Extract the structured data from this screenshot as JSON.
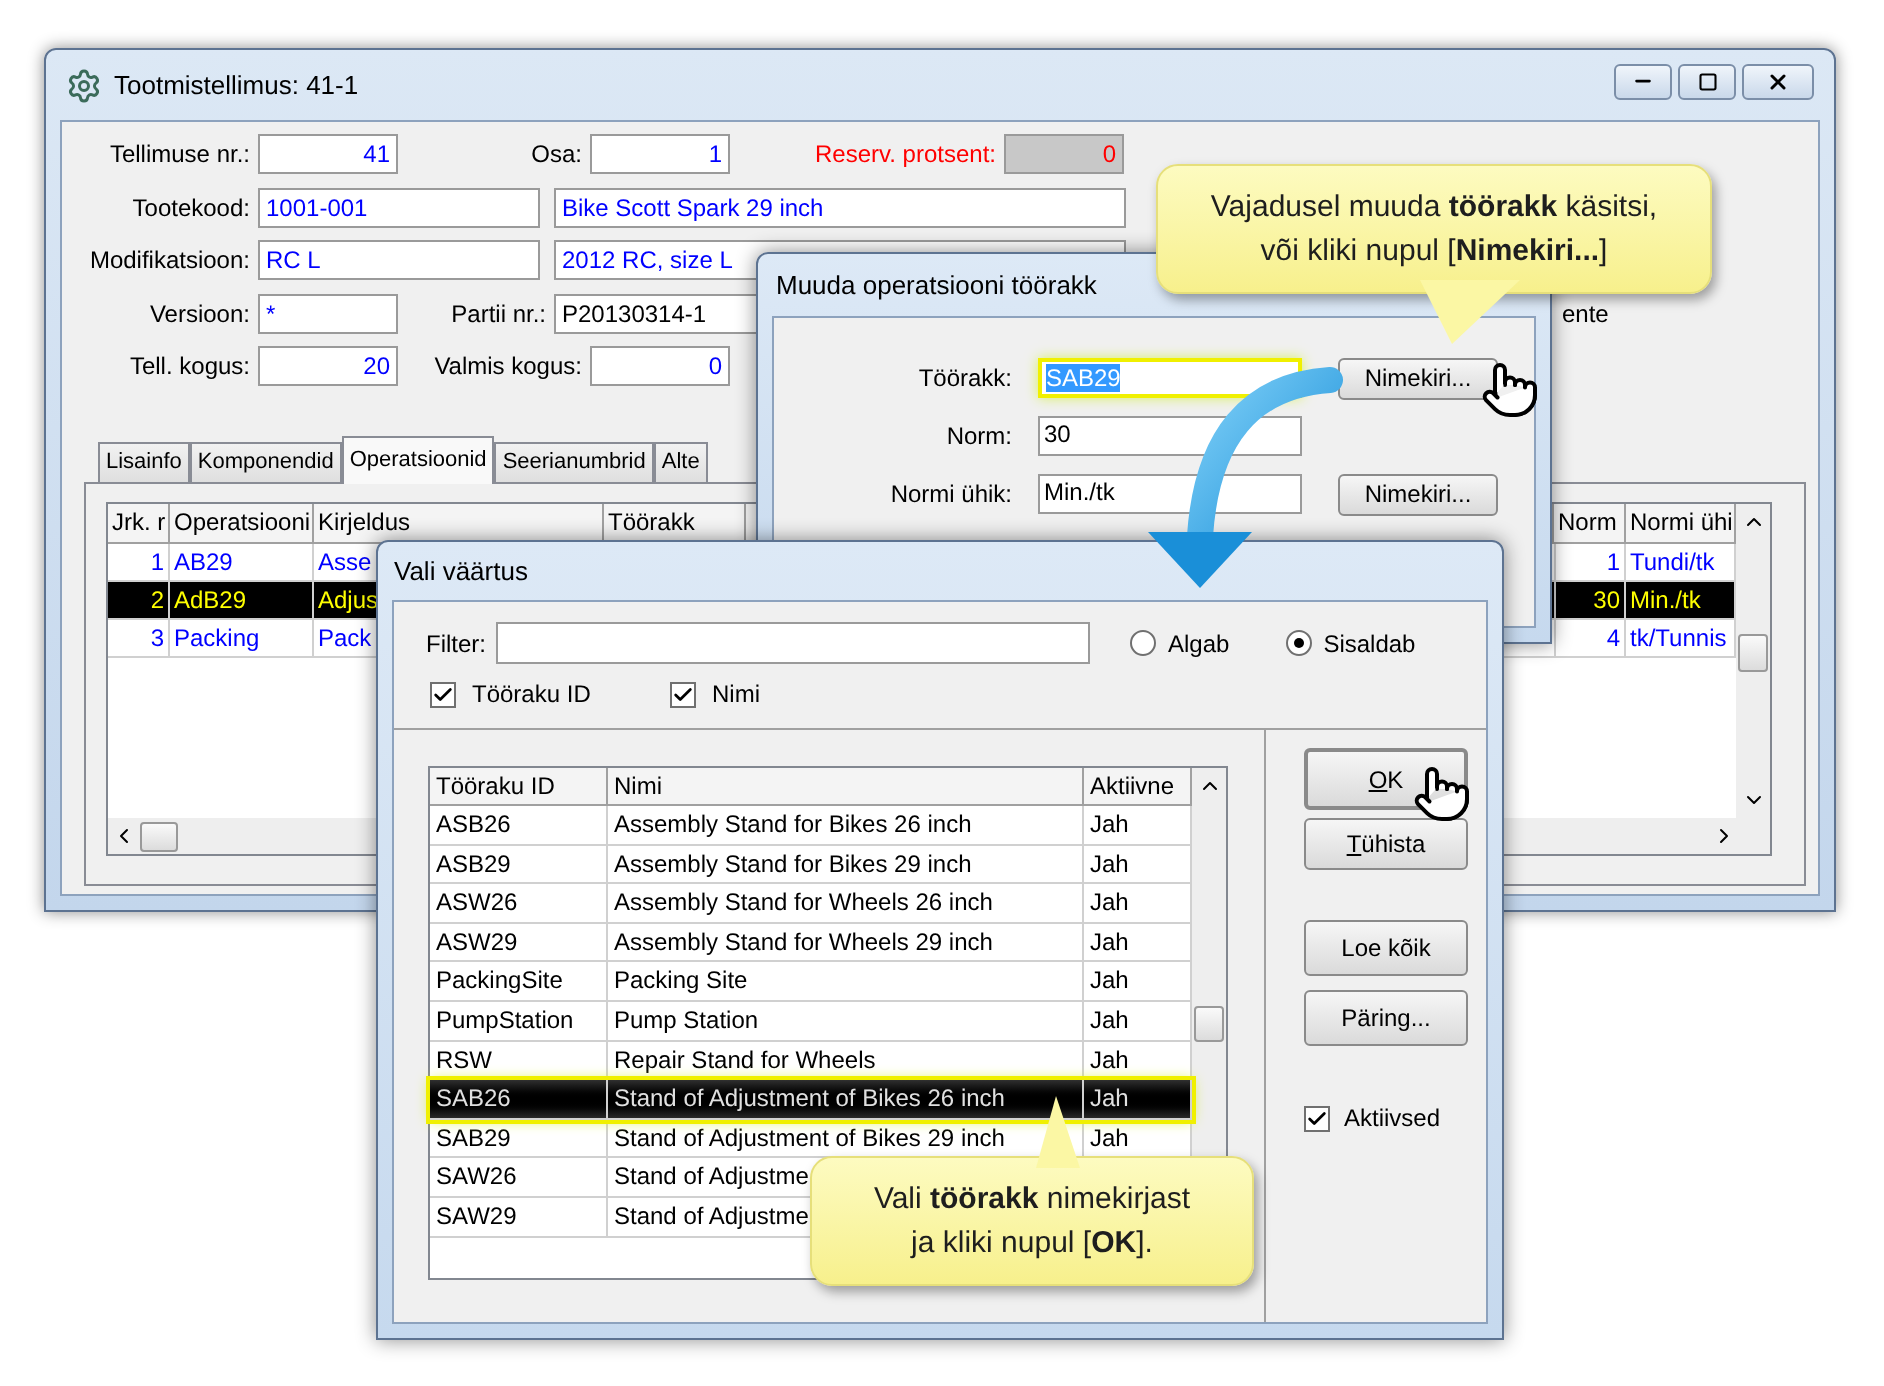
{
  "main_window": {
    "title": "Tootmistellimus: 41-1",
    "form_rows": [
      [
        {
          "label": "Tellimuse nr.:",
          "value": "41",
          "kind": "number"
        },
        {
          "label": "Osa:",
          "value": "1",
          "kind": "number"
        },
        {
          "label": "Reserv. protsent:",
          "value": "0",
          "kind": "readonly"
        }
      ],
      [
        {
          "label": "Tootekood:",
          "value": "1001-001",
          "kind": "text"
        },
        {
          "value": "Bike Scott Spark 29 inch",
          "kind": "text"
        }
      ],
      [
        {
          "label": "Modifikatsioon:",
          "value": "RC L",
          "kind": "text"
        },
        {
          "value": "2012 RC, size L",
          "kind": "text"
        }
      ],
      [
        {
          "label": "Versioon:",
          "value": "*",
          "kind": "text"
        },
        {
          "label": "Partii nr.:",
          "value": "P20130314-1",
          "kind": "plain"
        }
      ],
      [
        {
          "label": "Tell. kogus:",
          "value": "20",
          "kind": "number"
        },
        {
          "label": "Valmis kogus:",
          "value": "0",
          "kind": "number"
        }
      ]
    ],
    "cut_label": "ente",
    "tabs": [
      {
        "label": "Lisainfo",
        "selected": false
      },
      {
        "label": "Komponendid",
        "selected": false
      },
      {
        "label": "Operatsioonid",
        "selected": true
      },
      {
        "label": "Seerianumbrid",
        "selected": false
      },
      {
        "label": "Alte",
        "selected": false
      }
    ],
    "table": {
      "columns": [
        "Jrk. r",
        "Operatsiooni",
        "Kirjeldus",
        "Töörakk",
        "Norm",
        "Normi ühi"
      ],
      "rows": [
        {
          "jrk": "1",
          "operation": "AB29",
          "description": "Asse",
          "norm": "1",
          "unit": "Tundi/tk",
          "selected": false
        },
        {
          "jrk": "2",
          "operation": "AdB29",
          "description": "Adjus",
          "norm": "30",
          "unit": "Min./tk",
          "selected": true
        },
        {
          "jrk": "3",
          "operation": "Packing",
          "description": "Pack",
          "norm": "4",
          "unit": "tk/Tunnis",
          "selected": false
        }
      ]
    }
  },
  "edit_dialog": {
    "title": "Muuda operatsiooni töörakk",
    "fields": [
      {
        "label": "Töörakk:",
        "value": "SAB29",
        "highlighted": true,
        "button": "Nimekiri..."
      },
      {
        "label": "Norm:",
        "value": "30",
        "highlighted": false
      },
      {
        "label": "Normi ühik:",
        "value": "Min./tk",
        "highlighted": false,
        "button": "Nimekiri..."
      }
    ]
  },
  "picker_dialog": {
    "title": "Vali väärtus",
    "filter": {
      "label": "Filter:"
    },
    "match_options": [
      {
        "label": "Algab",
        "selected": false
      },
      {
        "label": "Sisaldab",
        "selected": true
      }
    ],
    "search_fields": [
      {
        "label": "Tööraku ID",
        "checked": true
      },
      {
        "label": "Nimi",
        "checked": true
      }
    ],
    "table": {
      "columns": [
        "Tööraku ID",
        "Nimi",
        "Aktiivne"
      ],
      "rows": [
        {
          "id": "ASB26",
          "name": "Assembly Stand for Bikes 26 inch",
          "active": "Jah",
          "selected": false
        },
        {
          "id": "ASB29",
          "name": "Assembly Stand for Bikes 29 inch",
          "active": "Jah",
          "selected": false
        },
        {
          "id": "ASW26",
          "name": "Assembly Stand for Wheels 26 inch",
          "active": "Jah",
          "selected": false
        },
        {
          "id": "ASW29",
          "name": "Assembly Stand for Wheels 29 inch",
          "active": "Jah",
          "selected": false
        },
        {
          "id": "PackingSite",
          "name": "Packing Site",
          "active": "Jah",
          "selected": false
        },
        {
          "id": "PumpStation",
          "name": "Pump Station",
          "active": "Jah",
          "selected": false
        },
        {
          "id": "RSW",
          "name": "Repair Stand for Wheels",
          "active": "Jah",
          "selected": false
        },
        {
          "id": "SAB26",
          "name": "Stand of Adjustment of Bikes 26 inch",
          "active": "Jah",
          "selected": true
        },
        {
          "id": "SAB29",
          "name": "Stand of Adjustment of Bikes 29 inch",
          "active": "Jah",
          "selected": false
        },
        {
          "id": "SAW26",
          "name": "Stand of Adjustme",
          "selected": false
        },
        {
          "id": "SAW29",
          "name": "Stand of Adjustme",
          "selected": false
        }
      ]
    },
    "buttons": [
      {
        "label": "OK",
        "mnemonic": true,
        "default": true
      },
      {
        "label": "Tühista",
        "mnemonic": true,
        "default": false
      },
      {
        "label": "Loe kõik",
        "mnemonic": false,
        "default": false
      },
      {
        "label": "Päring...",
        "mnemonic": false,
        "default": false
      }
    ],
    "active_only": {
      "label": "Aktiivsed",
      "checked": true
    }
  },
  "callouts": [
    {
      "lines": [
        "Vajadusel muuda **töörakk** käsitsi,",
        "või kliki nupul [**Nimekiri...**]"
      ]
    },
    {
      "lines": [
        "Vali **töörakk** nimekirjast",
        "ja kliki nupul [**OK**]."
      ]
    }
  ]
}
